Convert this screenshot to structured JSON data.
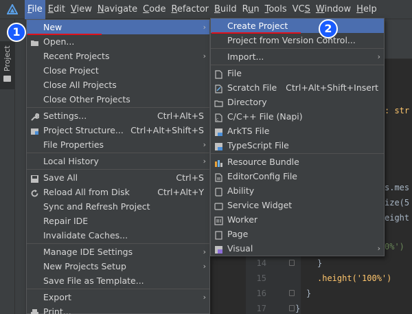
{
  "menubar": {
    "items": [
      "File",
      "Edit",
      "View",
      "Navigate",
      "Code",
      "Refactor",
      "Build",
      "Run",
      "Tools",
      "VCS",
      "Window",
      "Help"
    ],
    "mnemonics": [
      "F",
      "E",
      "V",
      "N",
      "C",
      "R",
      "B",
      "u",
      "T",
      "S",
      "W",
      "H"
    ]
  },
  "left_strip": {
    "project_tab": "Project"
  },
  "file_menu": {
    "items": [
      {
        "label": "New",
        "shortcut": "",
        "arrow": "›"
      },
      {
        "label": "Open...",
        "shortcut": "",
        "arrow": ""
      },
      {
        "label": "Recent Projects",
        "shortcut": "",
        "arrow": "›"
      },
      {
        "label": "Close Project",
        "shortcut": "",
        "arrow": ""
      },
      {
        "label": "Close All Projects",
        "shortcut": "",
        "arrow": ""
      },
      {
        "label": "Close Other Projects",
        "shortcut": "",
        "arrow": ""
      },
      {
        "label": "Settings...",
        "shortcut": "Ctrl+Alt+S",
        "arrow": ""
      },
      {
        "label": "Project Structure...",
        "shortcut": "Ctrl+Alt+Shift+S",
        "arrow": ""
      },
      {
        "label": "File Properties",
        "shortcut": "",
        "arrow": "›"
      },
      {
        "label": "Local History",
        "shortcut": "",
        "arrow": "›"
      },
      {
        "label": "Save All",
        "shortcut": "Ctrl+S",
        "arrow": ""
      },
      {
        "label": "Reload All from Disk",
        "shortcut": "Ctrl+Alt+Y",
        "arrow": ""
      },
      {
        "label": "Sync and Refresh Project",
        "shortcut": "",
        "arrow": ""
      },
      {
        "label": "Repair IDE",
        "shortcut": "",
        "arrow": ""
      },
      {
        "label": "Invalidate Caches...",
        "shortcut": "",
        "arrow": ""
      },
      {
        "label": "Manage IDE Settings",
        "shortcut": "",
        "arrow": "›"
      },
      {
        "label": "New Projects Setup",
        "shortcut": "",
        "arrow": "›"
      },
      {
        "label": "Save File as Template...",
        "shortcut": "",
        "arrow": ""
      },
      {
        "label": "Export",
        "shortcut": "",
        "arrow": "›"
      },
      {
        "label": "Print...",
        "shortcut": "",
        "arrow": ""
      }
    ]
  },
  "new_menu": {
    "items": [
      {
        "label": "Create Project",
        "shortcut": "",
        "arrow": ""
      },
      {
        "label": "Project from Version Control...",
        "shortcut": "",
        "arrow": ""
      },
      {
        "label": "Import...",
        "shortcut": "",
        "arrow": "›"
      },
      {
        "label": "File",
        "shortcut": "",
        "arrow": ""
      },
      {
        "label": "Scratch File",
        "shortcut": "Ctrl+Alt+Shift+Insert",
        "arrow": ""
      },
      {
        "label": "Directory",
        "shortcut": "",
        "arrow": ""
      },
      {
        "label": "C/C++ File (Napi)",
        "shortcut": "",
        "arrow": ""
      },
      {
        "label": "ArkTS File",
        "shortcut": "",
        "arrow": ""
      },
      {
        "label": "TypeScript File",
        "shortcut": "",
        "arrow": ""
      },
      {
        "label": "Resource Bundle",
        "shortcut": "",
        "arrow": ""
      },
      {
        "label": "EditorConfig File",
        "shortcut": "",
        "arrow": ""
      },
      {
        "label": "Ability",
        "shortcut": "",
        "arrow": ""
      },
      {
        "label": "Service Widget",
        "shortcut": "",
        "arrow": ""
      },
      {
        "label": "Worker",
        "shortcut": "",
        "arrow": ""
      },
      {
        "label": "Page",
        "shortcut": "",
        "arrow": ""
      },
      {
        "label": "Visual",
        "shortcut": "",
        "arrow": "›"
      }
    ]
  },
  "editor": {
    "fragments": [
      ": str",
      "s.mes",
      "ize(5",
      "eight",
      "0%')"
    ],
    "lines": [
      {
        "num": "14",
        "code": "}"
      },
      {
        "num": "15",
        "code": ".height('100%')"
      },
      {
        "num": "16",
        "code": "}"
      },
      {
        "num": "17",
        "code": "}"
      }
    ]
  },
  "annotations": {
    "badge1": "1",
    "badge2": "2"
  },
  "colors": {
    "accent": "#4b6eaf",
    "underline": "#e0101a",
    "badge": "#1a5cff"
  }
}
